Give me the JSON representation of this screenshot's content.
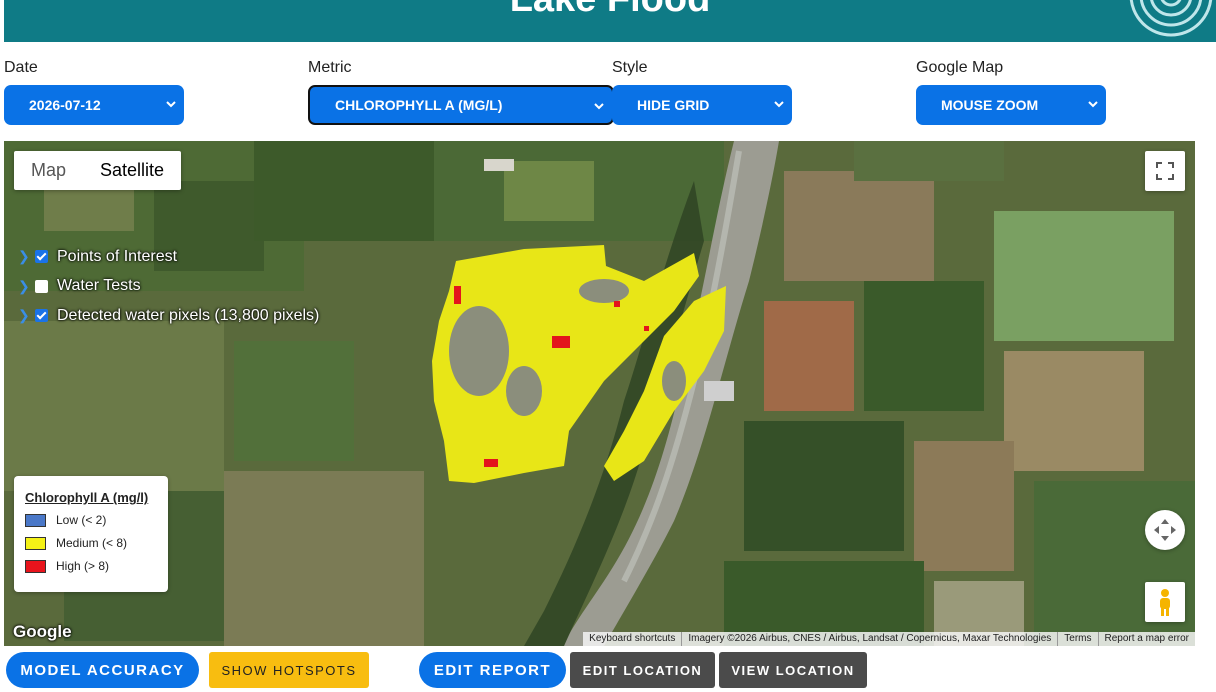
{
  "header": {
    "title": "Lake Flood"
  },
  "controls": {
    "date": {
      "label": "Date",
      "value": "2026-07-12"
    },
    "metric": {
      "label": "Metric",
      "value": "CHLOROPHYLL A (MG/L)"
    },
    "style": {
      "label": "Style",
      "value": "HIDE GRID"
    },
    "google_map": {
      "label": "Google Map",
      "value": "MOUSE ZOOM"
    }
  },
  "map": {
    "type_buttons": [
      "Map",
      "Satellite"
    ],
    "active_type": "Satellite",
    "layers": [
      {
        "label": "Points of Interest",
        "checked": true
      },
      {
        "label": "Water Tests",
        "checked": false
      },
      {
        "label": "Detected water pixels (13,800 pixels)",
        "checked": true
      }
    ],
    "legend": {
      "title": "Chlorophyll A (mg/l)",
      "items": [
        {
          "label": "Low (< 2)",
          "color": "#4a78c8"
        },
        {
          "label": "Medium (< 8)",
          "color": "#f5f216"
        },
        {
          "label": "High (> 8)",
          "color": "#e8141c"
        }
      ]
    },
    "google_logo": "Google",
    "attribution": {
      "shortcuts": "Keyboard shortcuts",
      "imagery": "Imagery ©2026 Airbus, CNES / Airbus, Landsat / Copernicus, Maxar Technologies",
      "terms": "Terms",
      "report": "Report a map error"
    }
  },
  "actions": {
    "model_accuracy": "MODEL ACCURACY",
    "show_hotspots": "SHOW HOTSPOTS",
    "edit_report": "EDIT REPORT",
    "edit_location": "EDIT LOCATION",
    "view_location": "VIEW LOCATION"
  }
}
